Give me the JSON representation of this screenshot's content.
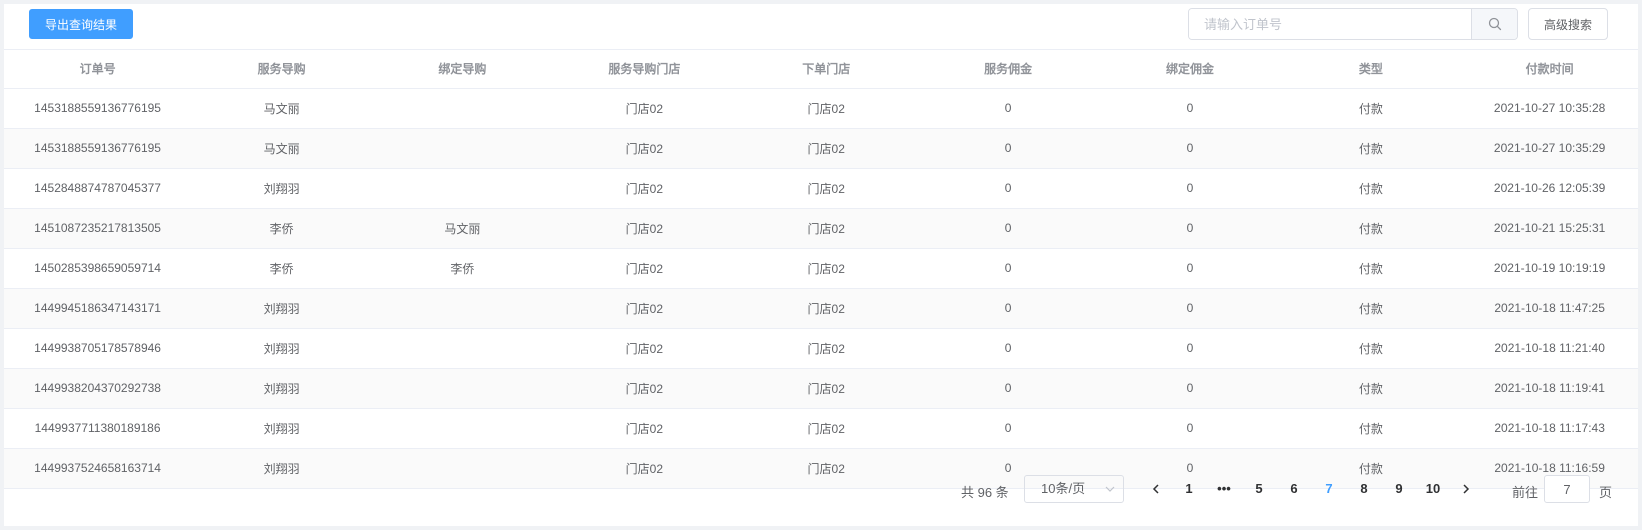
{
  "toolbar": {
    "export_label": "导出查询结果",
    "search_placeholder": "请输入订单号",
    "search_value": "",
    "advanced_label": "高级搜索"
  },
  "table": {
    "headers": [
      "订单号",
      "服务导购",
      "绑定导购",
      "服务导购门店",
      "下单门店",
      "服务佣金",
      "绑定佣金",
      "类型",
      "付款时间"
    ],
    "rows": [
      [
        "1453188559136776195",
        "马文丽",
        "",
        "门店02",
        "门店02",
        "0",
        "0",
        "付款",
        "2021-10-27 10:35:28"
      ],
      [
        "1453188559136776195",
        "马文丽",
        "",
        "门店02",
        "门店02",
        "0",
        "0",
        "付款",
        "2021-10-27 10:35:29"
      ],
      [
        "1452848874787045377",
        "刘翔羽",
        "",
        "门店02",
        "门店02",
        "0",
        "0",
        "付款",
        "2021-10-26 12:05:39"
      ],
      [
        "1451087235217813505",
        "李侨",
        "马文丽",
        "门店02",
        "门店02",
        "0",
        "0",
        "付款",
        "2021-10-21 15:25:31"
      ],
      [
        "1450285398659059714",
        "李侨",
        "李侨",
        "门店02",
        "门店02",
        "0",
        "0",
        "付款",
        "2021-10-19 10:19:19"
      ],
      [
        "1449945186347143171",
        "刘翔羽",
        "",
        "门店02",
        "门店02",
        "0",
        "0",
        "付款",
        "2021-10-18 11:47:25"
      ],
      [
        "1449938705178578946",
        "刘翔羽",
        "",
        "门店02",
        "门店02",
        "0",
        "0",
        "付款",
        "2021-10-18 11:21:40"
      ],
      [
        "1449938204370292738",
        "刘翔羽",
        "",
        "门店02",
        "门店02",
        "0",
        "0",
        "付款",
        "2021-10-18 11:19:41"
      ],
      [
        "1449937711380189186",
        "刘翔羽",
        "",
        "门店02",
        "门店02",
        "0",
        "0",
        "付款",
        "2021-10-18 11:17:43"
      ],
      [
        "1449937524658163714",
        "刘翔羽",
        "",
        "门店02",
        "门店02",
        "0",
        "0",
        "付款",
        "2021-10-18 11:16:59"
      ]
    ]
  },
  "pagination": {
    "total_text": "共 96 条",
    "page_size": "10条/页",
    "pages": [
      "1",
      "•••",
      "5",
      "6",
      "7",
      "8",
      "9",
      "10"
    ],
    "current_page": "7",
    "goto_label": "前往",
    "goto_value": "7",
    "page_suffix": "页"
  },
  "colors": {
    "primary": "#409eff",
    "text": "#606266",
    "header_text": "#909399",
    "border": "#ebeef5"
  },
  "icons": [
    "search-icon",
    "chevron-left-icon",
    "chevron-right-icon",
    "chevron-down-icon"
  ]
}
